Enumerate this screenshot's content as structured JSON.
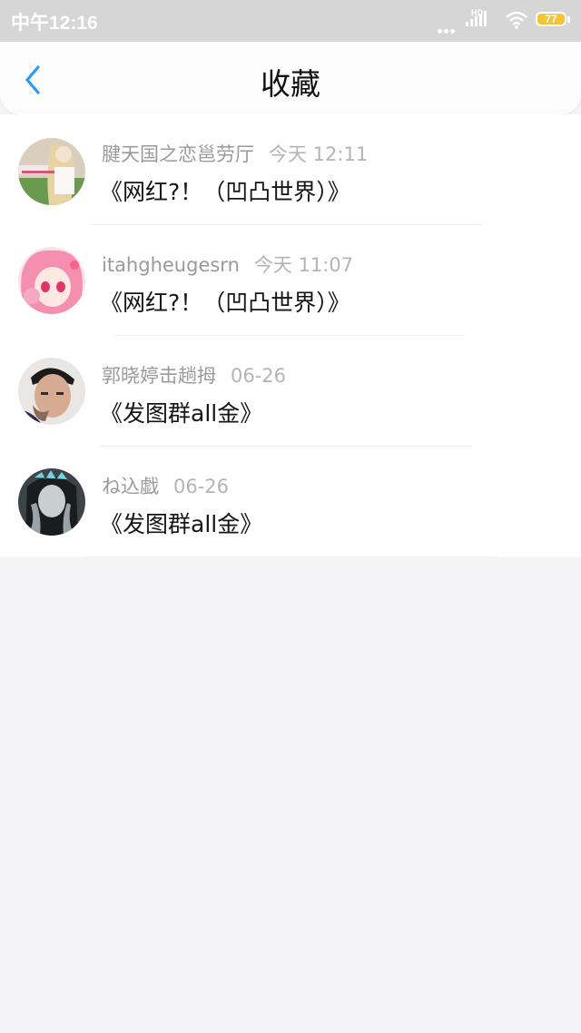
{
  "status_bar": {
    "time": "中午12:16",
    "network_label": "HD",
    "battery_level": "77",
    "battery_color": "#f5c33b"
  },
  "nav": {
    "back_icon": "chevron-left-icon",
    "title": "收藏",
    "accent_color": "#2a9bf0"
  },
  "favorites": [
    {
      "author": "腱天国之恋邕劳厅",
      "time": "今天 12:11",
      "title": "《网红?！（凹凸世界）》"
    },
    {
      "author": "itahgheugesrn",
      "time": "今天 11:07",
      "title": "《网红?！（凹凸世界）》"
    },
    {
      "author": "郭晓婷击趟拇",
      "time": "06-26",
      "title": "《发图群all金》"
    },
    {
      "author": "ね込戯",
      "time": "06-26",
      "title": "《发图群all金》"
    }
  ]
}
